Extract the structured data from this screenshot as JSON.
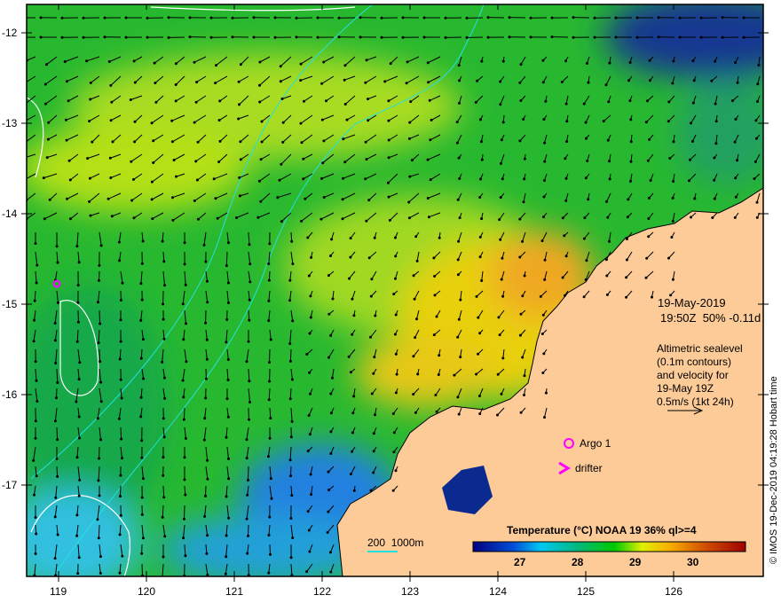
{
  "map": {
    "x_ticks": [
      "119",
      "120",
      "121",
      "122",
      "123",
      "124",
      "125",
      "126"
    ],
    "y_ticks": [
      "-12",
      "-13",
      "-14",
      "-15",
      "-16",
      "-17"
    ],
    "colors": {
      "land": "#fccb98",
      "sea_main": "#22b62a",
      "contour": "#ffffff",
      "isobath": "#22e0e0",
      "marker": "#ff00ff"
    }
  },
  "annotation": {
    "date": "19-May-2019",
    "time_line": "19:50Z  50% -0.11d",
    "altimetry_lines": [
      "Altimetric sealevel",
      "(0.1m contours)",
      "and velocity for",
      "19-May 19Z",
      "0.5m/s (1kt 24h)"
    ]
  },
  "legend": {
    "argo": "Argo 1",
    "drifter": "drifter",
    "isobaths": "200  1000m"
  },
  "colorbar": {
    "title": "Temperature (°C) NOAA 19 36% ql>=4",
    "ticks": [
      "27",
      "28",
      "29",
      "30"
    ],
    "colors": [
      "#000080",
      "#0060e0",
      "#00c8f0",
      "#00b870",
      "#00c800",
      "#e8f000",
      "#f8a000",
      "#d05000",
      "#a00000"
    ]
  },
  "credit": "© IMOS 19-Dec-2019 04:19:28 Hobart time"
}
